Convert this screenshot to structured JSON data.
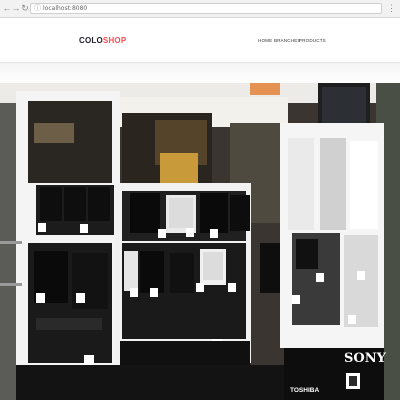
{
  "browser": {
    "url": "localhost:8080",
    "icons": {
      "back": "arrow-left-icon",
      "forward": "arrow-right-icon",
      "reload": "reload-icon",
      "info": "info-icon",
      "menu": "menu-icon"
    }
  },
  "header": {
    "logo_part1": "COLO",
    "logo_part2": "SHOP",
    "nav": {
      "home": "HOME",
      "branches": "BRANCHES",
      "products": "PRODUCTS"
    }
  },
  "hero": {
    "brand_sony": "SONY",
    "brand_toshiba": "TOSHIBA"
  },
  "colors": {
    "brand_dark": "#1e1e27",
    "accent": "#fe4c50"
  }
}
